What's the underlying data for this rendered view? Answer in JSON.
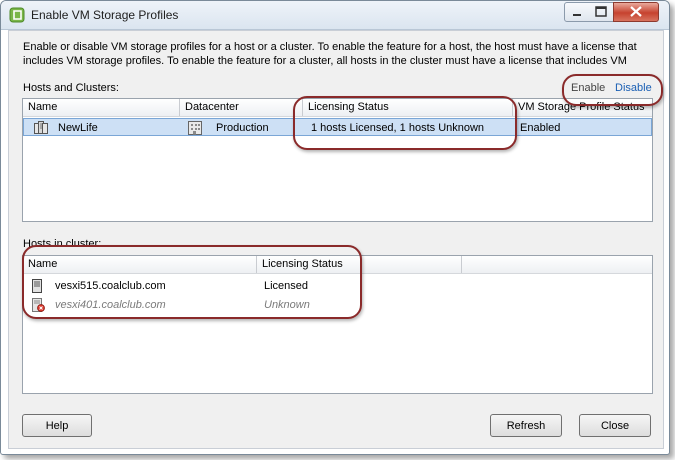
{
  "window": {
    "title": "Enable VM Storage Profiles"
  },
  "description": "Enable or disable VM storage profiles for a host or a cluster. To enable the feature for a host, the host must have a license that includes VM storage profiles. To enable the feature for a cluster, all hosts in the cluster must have a license that includes VM",
  "hosts_clusters": {
    "label": "Hosts and Clusters:",
    "enable_label": "Enable",
    "disable_label": "Disable",
    "columns": [
      "Name",
      "Datacenter",
      "Licensing Status",
      "VM Storage Profile Status"
    ],
    "rows": [
      {
        "name": "NewLife",
        "datacenter": "Production",
        "licensing": "1 hosts Licensed, 1 hosts Unknown",
        "status": "Enabled"
      }
    ]
  },
  "hosts_in_cluster": {
    "label": "Hosts in cluster:",
    "columns": [
      "Name",
      "Licensing Status"
    ],
    "rows": [
      {
        "name": "vesxi515.coalclub.com",
        "licensing": "Licensed"
      },
      {
        "name": "vesxi401.coalclub.com",
        "licensing": "Unknown"
      }
    ]
  },
  "buttons": {
    "help": "Help",
    "refresh": "Refresh",
    "close": "Close"
  },
  "colors": {
    "annotation_ring": "#8a2a2a",
    "link_blue": "#1a5fb4",
    "selection": "#cde0f5"
  }
}
